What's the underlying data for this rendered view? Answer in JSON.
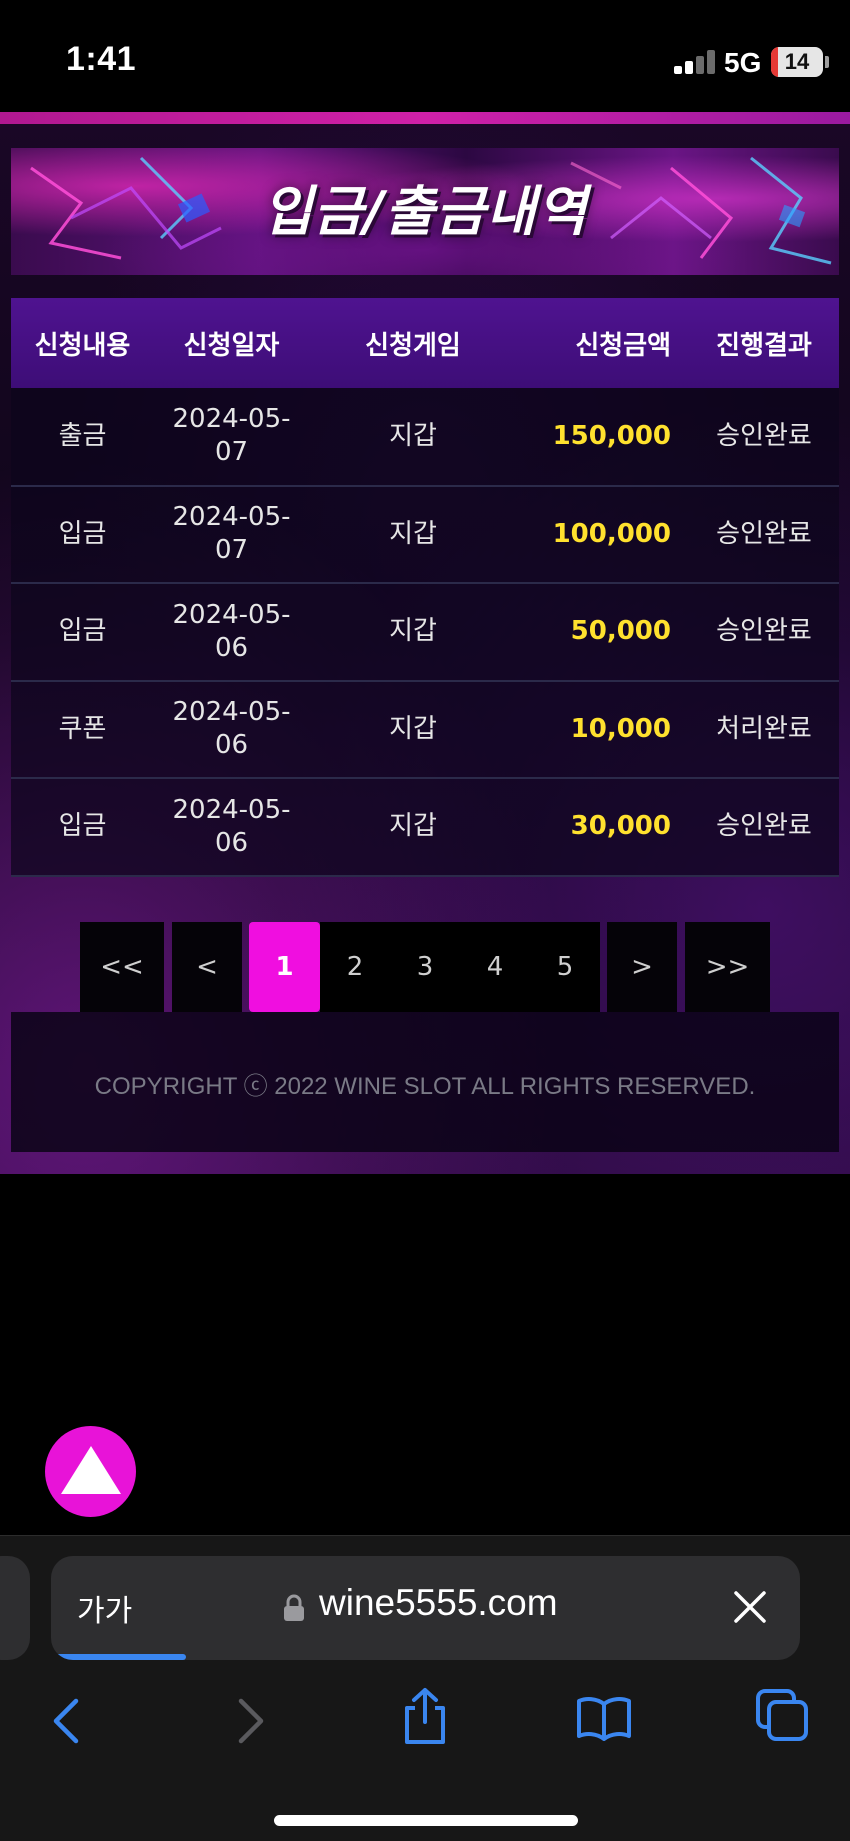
{
  "status_bar": {
    "time": "1:41",
    "network": "5G",
    "battery": "14",
    "battery_level": 0.14,
    "battery_color": "#e53935"
  },
  "page": {
    "title": "입금/출금내역",
    "accent_color": "#f00ee0",
    "amount_color": "#ffe12e"
  },
  "table": {
    "headers": [
      "신청내용",
      "신청일자",
      "신청게임",
      "신청금액",
      "진행결과"
    ],
    "rows": [
      {
        "type": "출금",
        "date": "2024-05-07",
        "game": "지갑",
        "amount": "150,000",
        "result": "승인완료"
      },
      {
        "type": "입금",
        "date": "2024-05-07",
        "game": "지갑",
        "amount": "100,000",
        "result": "승인완료"
      },
      {
        "type": "입금",
        "date": "2024-05-06",
        "game": "지갑",
        "amount": "50,000",
        "result": "승인완료"
      },
      {
        "type": "쿠폰",
        "date": "2024-05-06",
        "game": "지갑",
        "amount": "10,000",
        "result": "처리완료"
      },
      {
        "type": "입금",
        "date": "2024-05-06",
        "game": "지갑",
        "amount": "30,000",
        "result": "승인완료"
      }
    ]
  },
  "pagination": {
    "first": "<<",
    "prev": "<",
    "pages": [
      "1",
      "2",
      "3",
      "4",
      "5"
    ],
    "current": "1",
    "next": ">",
    "last": ">>"
  },
  "footer": {
    "copyright": "COPYRIGHT ⓒ 2022 WINE SLOT ALL RIGHTS RESERVED."
  },
  "browser": {
    "text_size_label": "가가",
    "url": "wine5555.com",
    "load_progress": 0.18,
    "icons": [
      "lock-icon",
      "close-icon",
      "back-icon",
      "forward-icon",
      "share-icon",
      "bookmarks-icon",
      "tabs-icon",
      "scroll-top-icon"
    ]
  }
}
